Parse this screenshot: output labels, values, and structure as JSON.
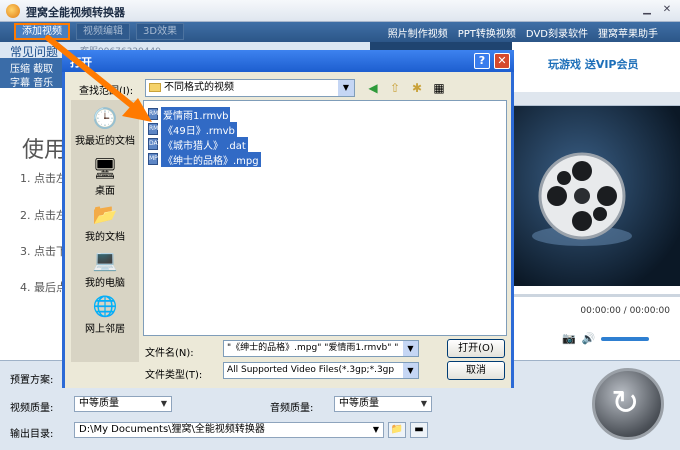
{
  "app": {
    "title": "狸窝全能视频转换器"
  },
  "toolbar": {
    "add_video": "添加视频",
    "edit_video": "视频编辑",
    "effect_3d": "3D效果",
    "links": [
      "照片制作视频",
      "PPT转换视频",
      "DVD刻录软件",
      "狸窝苹果助手"
    ]
  },
  "left": {
    "faq": "常见问题",
    "qq": "客服99676329449",
    "tags_row1": "压缩  截取",
    "tags_row2": "字幕  音乐",
    "use_title": "使用",
    "steps": [
      "1. 点击左",
      "2. 点击左",
      "3. 点击下",
      "4. 最后点"
    ]
  },
  "right": {
    "vip_text": "玩游戏  送VIP会员",
    "time": "00:00:00 / 00:00:00"
  },
  "bottom": {
    "preset_label": "预置方案:",
    "video_quality_label": "视频质量:",
    "video_quality": "中等质量",
    "audio_quality_label": "音频质量:",
    "audio_quality": "中等质量",
    "output_label": "输出目录:",
    "output_path": "D:\\My Documents\\狸窝\\全能视频转换器"
  },
  "dialog": {
    "title": "打开",
    "look_in_label": "查找范围(I):",
    "look_in_value": "不同格式的视频",
    "places": [
      "我最近的文档",
      "桌面",
      "我的文档",
      "我的电脑",
      "网上邻居"
    ],
    "files": [
      {
        "name": "爱情雨1.rmvb",
        "ext": "RM"
      },
      {
        "name": "《49日》.rmvb",
        "ext": "RM"
      },
      {
        "name": "《城市猎人》 .dat",
        "ext": "DAT"
      },
      {
        "name": "《绅士的品格》.mpg",
        "ext": "MPG"
      }
    ],
    "filename_label": "文件名(N):",
    "filename_value": "\"《绅士的品格》.mpg\" \"爱情雨1.rmvb\" \"",
    "filetype_label": "文件类型(T):",
    "filetype_value": "All Supported Video Files(*.3gp;*.3gp",
    "open_button": "打开(O)",
    "cancel_button": "取消"
  },
  "colors": {
    "accent": "#ff7a00",
    "dialog_title": "#2c6ad6",
    "selection": "#316ac5"
  },
  "icons": [
    "close-icon",
    "minimize-icon",
    "help-icon",
    "folder-icon",
    "back-icon",
    "up-folder-icon",
    "new-folder-icon",
    "view-menu-icon",
    "recent-docs-icon",
    "desktop-icon",
    "my-documents-icon",
    "my-computer-icon",
    "network-icon",
    "film-reel-icon",
    "camera-icon",
    "volume-icon",
    "convert-icon"
  ]
}
